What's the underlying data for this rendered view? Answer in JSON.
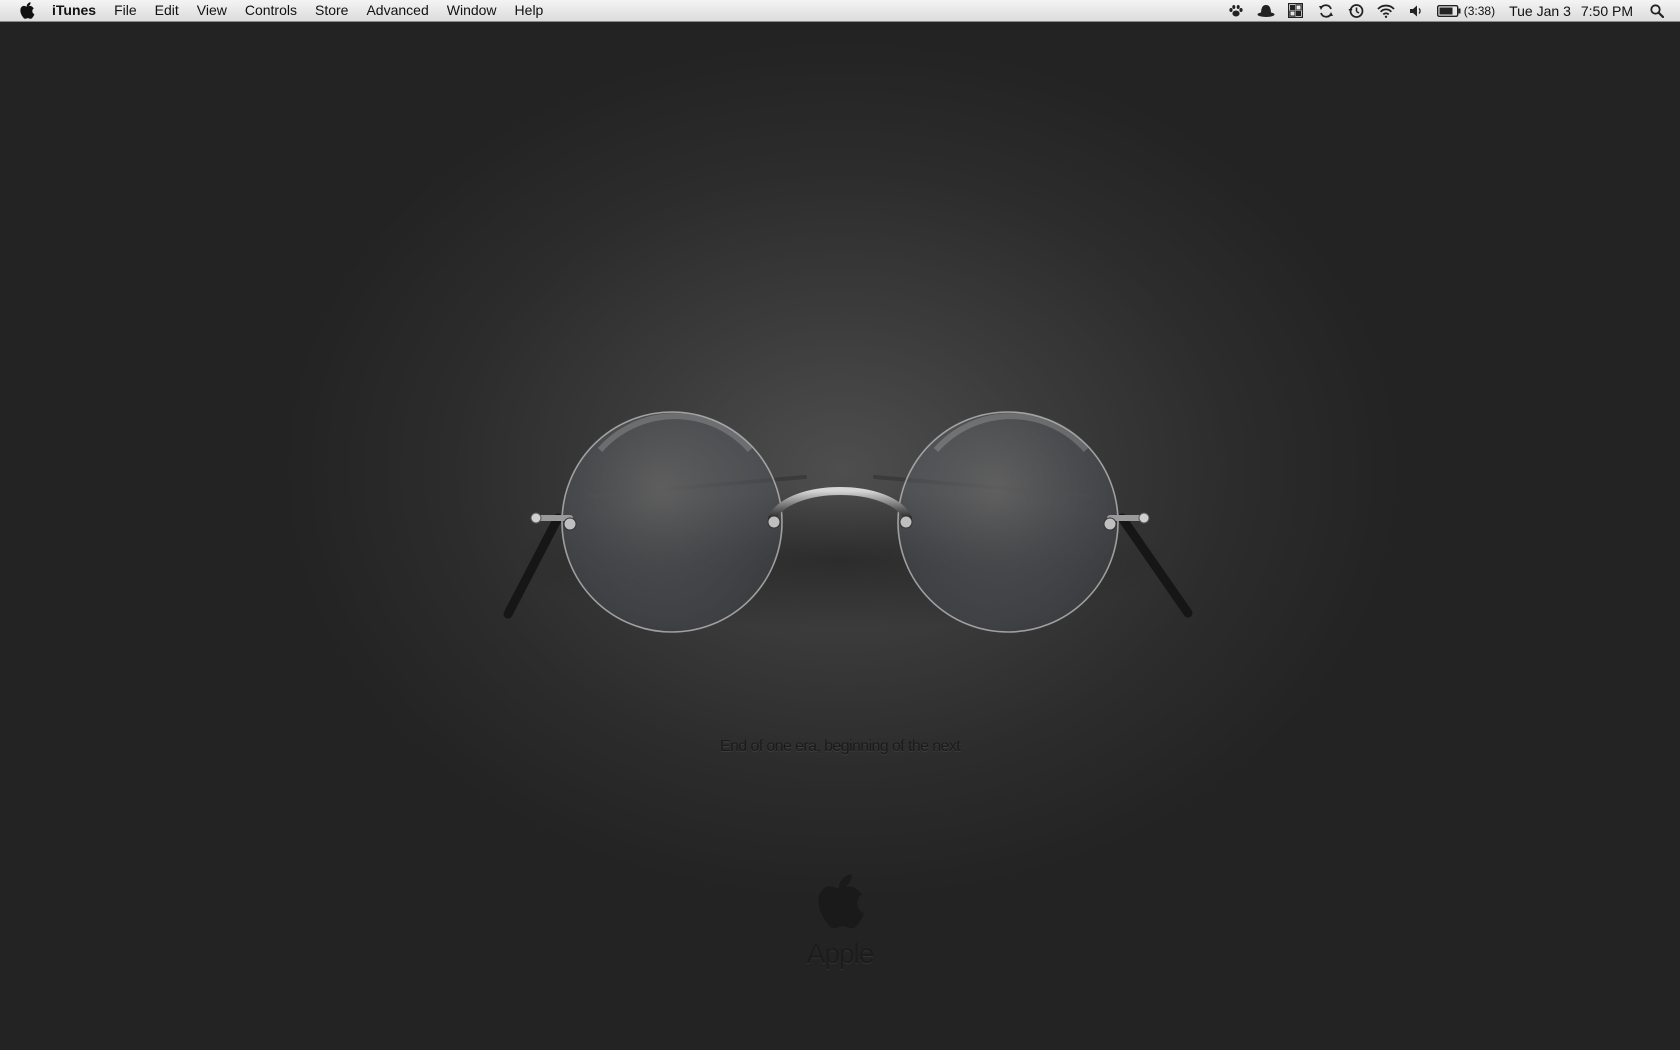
{
  "menubar": {
    "app_name": "iTunes",
    "menus": [
      "File",
      "Edit",
      "View",
      "Controls",
      "Store",
      "Advanced",
      "Window",
      "Help"
    ],
    "status": {
      "battery_time": "(3:38)",
      "date": "Tue Jan 3",
      "time": "7:50 PM"
    },
    "icons": [
      "apple-icon",
      "paw-icon",
      "hat-icon",
      "grid-icon",
      "sync-icon",
      "time-machine-icon",
      "wifi-icon",
      "volume-icon",
      "battery-icon",
      "spotlight-icon"
    ]
  },
  "wallpaper": {
    "tagline": "End of one era, beginning of the next",
    "brand": "Apple",
    "background_color": "#2a2a2a",
    "text_color": "#1b1b1b"
  }
}
